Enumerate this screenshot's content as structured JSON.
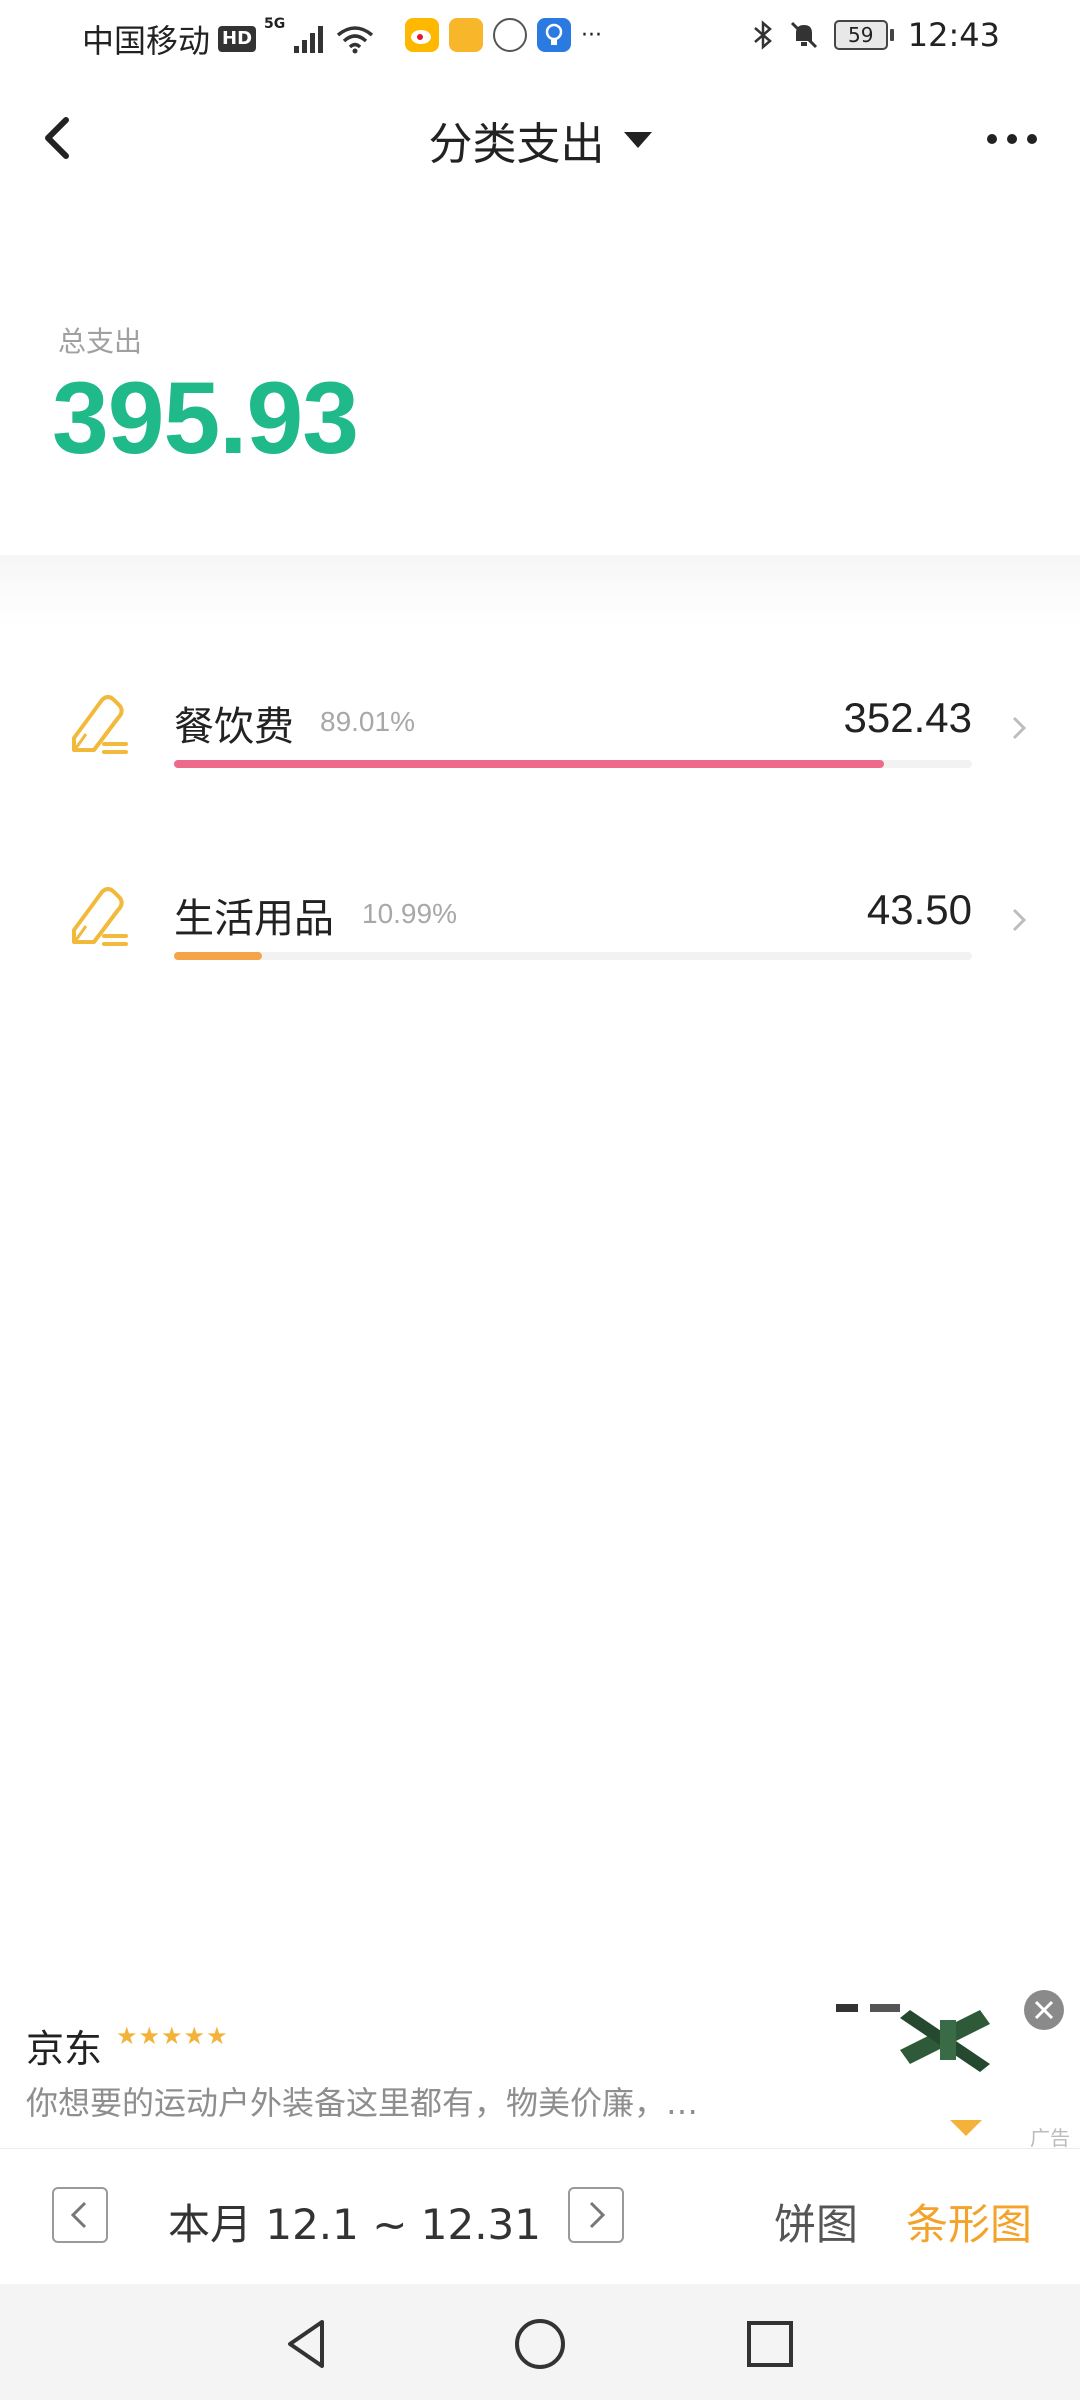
{
  "status_bar": {
    "carrier": "中国移动",
    "hd": "HD",
    "network": "5G",
    "more": "···",
    "battery": "59",
    "time": "12:43"
  },
  "header": {
    "title": "分类支出"
  },
  "summary": {
    "label": "总支出",
    "value": "395.93",
    "accent_color": "#1fb98a"
  },
  "categories": [
    {
      "name": "餐饮费",
      "percent": "89.01%",
      "amount": "352.43",
      "share": 0.8901,
      "bar_color": "#ee6a8a",
      "icon": "pencil-icon"
    },
    {
      "name": "生活用品",
      "percent": "10.99%",
      "amount": "43.50",
      "share": 0.1099,
      "bar_color": "#f5a449",
      "icon": "pencil-icon"
    }
  ],
  "ad": {
    "brand": "京东",
    "stars": "★★★★★",
    "text": "你想要的运动户外装备这里都有，物美价廉，…",
    "label": "广告"
  },
  "toolbar": {
    "range": "本月 12.1 ~ 12.31",
    "pie_label": "饼图",
    "bar_label": "条形图",
    "active_color": "#f3a32a"
  }
}
